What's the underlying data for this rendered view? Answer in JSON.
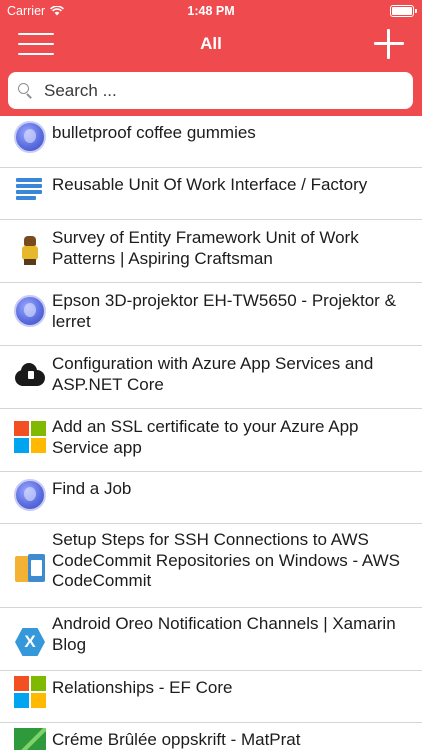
{
  "status_bar": {
    "carrier": "Carrier",
    "time": "1:48 PM"
  },
  "nav": {
    "title": "All"
  },
  "search": {
    "placeholder": "Search ..."
  },
  "colors": {
    "accent": "#ef4b4f",
    "separator": "#d5d5d7"
  },
  "items": [
    {
      "title": "bulletproof coffee gummies",
      "icon": "globe-icon"
    },
    {
      "title": "Reusable Unit Of Work Interface / Factory",
      "icon": "stack-icon"
    },
    {
      "title": "Survey of Entity Framework Unit of Work Patterns | Aspiring Craftsman",
      "icon": "figure-icon"
    },
    {
      "title": "Epson 3D-projektor EH-TW5650 - Projektor & lerret",
      "icon": "globe-icon"
    },
    {
      "title": "Configuration with Azure App Services and ASP.NET Core",
      "icon": "cloud-icon"
    },
    {
      "title": "Add an SSL certificate to your Azure App Service app",
      "icon": "microsoft-icon"
    },
    {
      "title": "Find a Job",
      "icon": "globe-icon"
    },
    {
      "title": "Setup Steps for SSH Connections to AWS CodeCommit Repositories on Windows - AWS CodeCommit",
      "icon": "aws-icon"
    },
    {
      "title": "Android Oreo Notification Channels | Xamarin Blog",
      "icon": "xamarin-icon"
    },
    {
      "title": "Relationships - EF Core",
      "icon": "microsoft-icon"
    },
    {
      "title": "Créme Brûlée oppskrift - MatPrat",
      "icon": "matprat-icon"
    }
  ]
}
